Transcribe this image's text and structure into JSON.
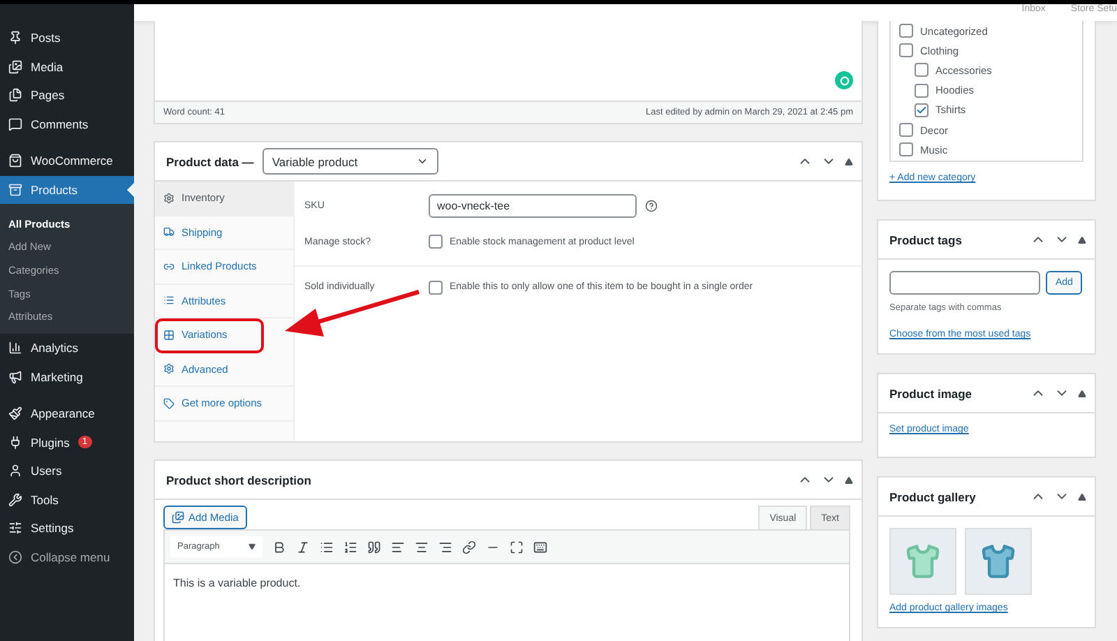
{
  "top_bar": {
    "links": [
      "Inbox",
      "Store Setu"
    ]
  },
  "sidebar": {
    "groups": [
      [
        {
          "label": "Posts",
          "selected": false
        },
        {
          "label": "Media",
          "selected": false
        },
        {
          "label": "Pages",
          "selected": false
        },
        {
          "label": "Comments",
          "selected": false
        }
      ],
      [
        {
          "label": "WooCommerce",
          "selected": false
        },
        {
          "label": "Products",
          "selected": true,
          "submenu": [
            {
              "label": "All Products",
              "selected": true
            },
            {
              "label": "Add New",
              "selected": false
            },
            {
              "label": "Categories",
              "selected": false
            },
            {
              "label": "Tags",
              "selected": false
            },
            {
              "label": "Attributes",
              "selected": false
            }
          ]
        },
        {
          "label": "Analytics",
          "selected": false
        },
        {
          "label": "Marketing",
          "selected": false
        }
      ],
      [
        {
          "label": "Appearance",
          "selected": false
        },
        {
          "label": "Plugins",
          "selected": false,
          "badge": "1"
        },
        {
          "label": "Users",
          "selected": false
        },
        {
          "label": "Tools",
          "selected": false
        },
        {
          "label": "Settings",
          "selected": false
        }
      ]
    ],
    "collapse": "Collapse menu"
  },
  "editor": {
    "word_count": "Word count: 41",
    "last_edited": "Last edited by admin on March 29, 2021 at 2:45 pm"
  },
  "product_data": {
    "title": "Product data —",
    "type_select": "Variable product",
    "tabs": [
      {
        "label": "Inventory",
        "selected": true,
        "highlighted": false
      },
      {
        "label": "Shipping",
        "selected": false,
        "highlighted": false
      },
      {
        "label": "Linked Products",
        "selected": false,
        "highlighted": false
      },
      {
        "label": "Attributes",
        "selected": false,
        "highlighted": false
      },
      {
        "label": "Variations",
        "selected": false,
        "highlighted": true
      },
      {
        "label": "Advanced",
        "selected": false,
        "highlighted": false
      },
      {
        "label": "Get more options",
        "selected": false,
        "highlighted": false
      }
    ],
    "fields": [
      {
        "kind": "text",
        "label": "SKU",
        "value": "woo-vneck-tee"
      },
      {
        "kind": "checkbox",
        "label": "Manage stock?",
        "text": "Enable stock management at product level",
        "checked": false
      },
      {
        "kind": "checkbox",
        "label": "Sold individually",
        "text": "Enable this to only allow one of this item to be bought in a single order",
        "checked": false
      }
    ]
  },
  "short_description": {
    "title": "Product short description",
    "add_media": "Add Media",
    "tabs": [
      {
        "label": "Visual",
        "selected": true
      },
      {
        "label": "Text",
        "selected": false
      }
    ],
    "format_select": "Paragraph",
    "content": "This is a variable product."
  },
  "categories": {
    "items": [
      {
        "label": "Uncategorized",
        "checked": false
      },
      {
        "label": "Clothing",
        "checked": false,
        "children": [
          {
            "label": "Accessories",
            "checked": false
          },
          {
            "label": "Hoodies",
            "checked": false
          },
          {
            "label": "Tshirts",
            "checked": true
          }
        ]
      },
      {
        "label": "Decor",
        "checked": false
      },
      {
        "label": "Music",
        "checked": false
      }
    ],
    "add_link": "+ Add new category"
  },
  "product_tags": {
    "title": "Product tags",
    "button": "Add",
    "hint": "Separate tags with commas",
    "link": "Choose from the most used tags"
  },
  "product_image": {
    "title": "Product image",
    "link": "Set product image"
  },
  "product_gallery": {
    "title": "Product gallery",
    "link": "Add product gallery images"
  }
}
